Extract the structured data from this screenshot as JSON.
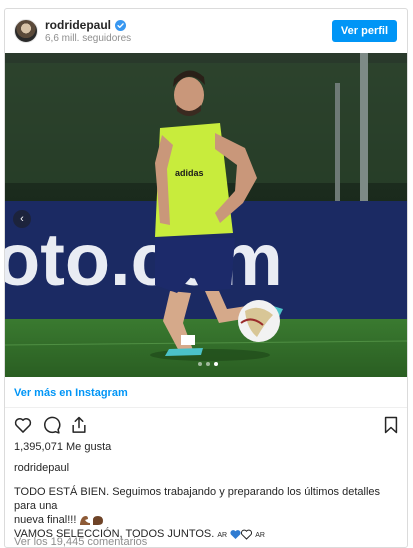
{
  "post": {
    "username": "rodridepaul",
    "followers": "6,6 mill. seguidores",
    "view_profile_label": "Ver perfil",
    "see_more_label": "Ver más en Instagram",
    "likes": "1,395,071 Me gusta",
    "owner": "rodridepaul",
    "caption_line1": "TODO ESTÁ BIEN. Seguimos trabajando y preparando los últimos detalles para una",
    "caption_line2": "nueva final!!!",
    "caption_line3": "VAMOS SELECCIÓN, TODOS JUNTOS.",
    "flag_label_1": "AR",
    "flag_label_2": "AR",
    "comments": "Ver los 19,445 comentarios",
    "photo_banner_text": "oto.com",
    "bib_brand": "adidas"
  },
  "colors": {
    "accent": "#0095f6",
    "pitch": "#2e6b2a",
    "banner": "#1b2a63",
    "bib": "#c8ec3c"
  },
  "icons": {
    "like": "heart-outline",
    "comment": "speech-bubble",
    "share": "share-arrow",
    "save": "bookmark"
  },
  "carousel": {
    "slides": 3,
    "active": 3
  }
}
